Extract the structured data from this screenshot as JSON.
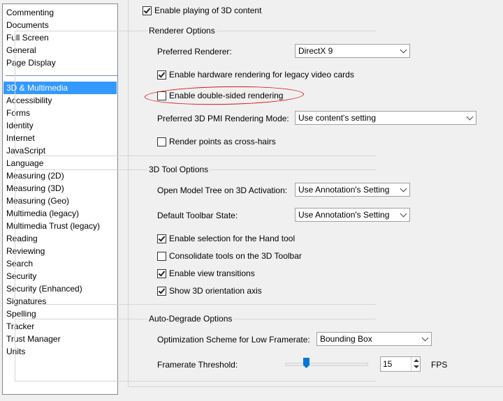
{
  "sidebar": {
    "items_top": [
      {
        "label": "Commenting"
      },
      {
        "label": "Documents"
      },
      {
        "label": "Full Screen"
      },
      {
        "label": "General"
      },
      {
        "label": "Page Display"
      }
    ],
    "items": [
      {
        "label": "3D & Multimedia"
      },
      {
        "label": "Accessibility"
      },
      {
        "label": "Forms"
      },
      {
        "label": "Identity"
      },
      {
        "label": "Internet"
      },
      {
        "label": "JavaScript"
      },
      {
        "label": "Language"
      },
      {
        "label": "Measuring (2D)"
      },
      {
        "label": "Measuring (3D)"
      },
      {
        "label": "Measuring (Geo)"
      },
      {
        "label": "Multimedia (legacy)"
      },
      {
        "label": "Multimedia Trust (legacy)"
      },
      {
        "label": "Reading"
      },
      {
        "label": "Reviewing"
      },
      {
        "label": "Search"
      },
      {
        "label": "Security"
      },
      {
        "label": "Security (Enhanced)"
      },
      {
        "label": "Signatures"
      },
      {
        "label": "Spelling"
      },
      {
        "label": "Tracker"
      },
      {
        "label": "Trust Manager"
      },
      {
        "label": "Units"
      }
    ],
    "selected": "3D & Multimedia"
  },
  "top": {
    "enable_3d_label": "Enable playing of 3D content",
    "enable_3d_checked": true
  },
  "renderer": {
    "title": "Renderer Options",
    "preferred_label": "Preferred Renderer:",
    "preferred_value": "DirectX 9",
    "hw_label": "Enable hardware rendering for legacy video cards",
    "hw_checked": true,
    "double_sided_label": "Enable double-sided rendering",
    "double_sided_checked": false,
    "pmi_label": "Preferred 3D PMI Rendering Mode:",
    "pmi_value": "Use content's setting",
    "crosshair_label": "Render points as cross-hairs",
    "crosshair_checked": false
  },
  "tool": {
    "title": "3D Tool Options",
    "model_tree_label": "Open Model Tree on 3D Activation:",
    "model_tree_value": "Use Annotation's Setting",
    "toolbar_state_label": "Default Toolbar State:",
    "toolbar_state_value": "Use Annotation's Setting",
    "hand_tool_label": "Enable selection for the Hand tool",
    "hand_tool_checked": true,
    "consolidate_label": "Consolidate tools on the 3D Toolbar",
    "consolidate_checked": false,
    "transitions_label": "Enable view transitions",
    "transitions_checked": true,
    "orientation_label": "Show 3D orientation axis",
    "orientation_checked": true
  },
  "degrade": {
    "title": "Auto-Degrade Options",
    "scheme_label": "Optimization Scheme for Low Framerate:",
    "scheme_value": "Bounding Box",
    "threshold_label": "Framerate Threshold:",
    "threshold_value": "15",
    "threshold_unit": "FPS"
  },
  "colors": {
    "selection": "#3399ff",
    "annotation": "#e01010"
  }
}
